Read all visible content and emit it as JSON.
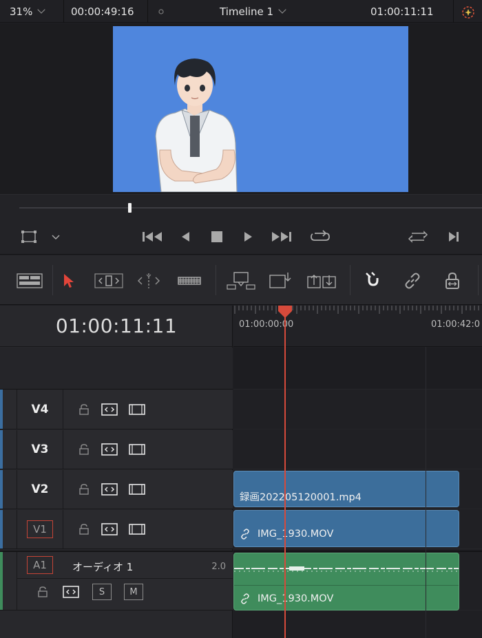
{
  "topbar": {
    "zoom": "31%",
    "source_timecode": "00:00:49:16",
    "timeline_name": "Timeline 1",
    "record_timecode": "01:00:11:11"
  },
  "icons": {
    "zoom_dropdown": "chevron-down-icon",
    "viewer_dot": "dot-icon",
    "timeline_dropdown": "chevron-down-icon",
    "effects": "sparkle-icon",
    "transform": "transform-icon",
    "prev": "jump-to-start-icon",
    "back": "play-reverse-icon",
    "stop": "stop-icon",
    "play": "play-icon",
    "next": "jump-to-end-icon",
    "loop": "loop-icon",
    "match_frame": "match-frame-icon",
    "next_clip": "next-edit-icon"
  },
  "toolbar": {
    "tools": [
      "timeline-view-options-icon",
      "selection-arrow-icon",
      "trim-edit-icon",
      "dynamic-trim-icon",
      "blade-icon",
      "insert-clip-icon",
      "overwrite-clip-icon",
      "replace-clip-icon",
      "snapping-magnet-icon",
      "linked-selection-icon",
      "position-lock-icon"
    ]
  },
  "timeline": {
    "current_timecode": "01:00:11:11",
    "ruler": [
      "01:00:00:00",
      "01:00:42:0"
    ],
    "video_tracks": [
      {
        "name": "V4",
        "boxed": false
      },
      {
        "name": "V3",
        "boxed": false
      },
      {
        "name": "V2",
        "boxed": false
      },
      {
        "name": "V1",
        "boxed": true
      }
    ],
    "audio_track": {
      "name": "A1",
      "label": "オーディオ 1",
      "channels": "2.0",
      "solo": "S",
      "mute": "M"
    },
    "clips": {
      "v2": "録画202205120001.mp4",
      "v1": "IMG_1930.MOV",
      "a1": "IMG_1930.MOV"
    }
  },
  "colors": {
    "video_clip": "#3c6e9b",
    "audio_clip": "#3f8c5c",
    "playhead": "#d64a3b",
    "video_bg": "#4f86dd"
  }
}
